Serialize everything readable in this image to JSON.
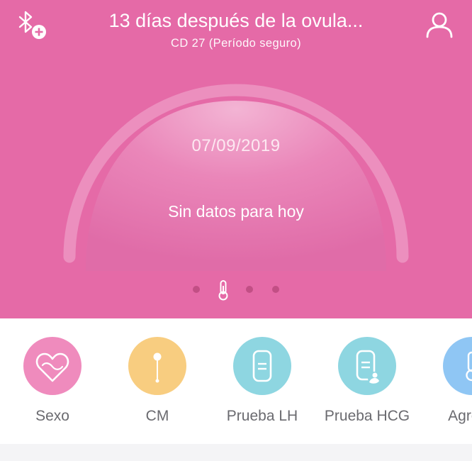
{
  "header": {
    "title": "13 días después de la ovula...",
    "subtitle": "CD 27 (Período seguro)",
    "bluetooth_icon": "bluetooth-add-icon",
    "profile_icon": "user-icon"
  },
  "gauge": {
    "date": "07/09/2019",
    "message": "Sin datos para hoy"
  },
  "pager": {
    "page_count": 4,
    "active_index": 1,
    "active_icon": "thermometer-icon"
  },
  "actions": [
    {
      "label": "Sexo",
      "icon": "heart-icon",
      "color": "#ef8bbd"
    },
    {
      "label": "CM",
      "icon": "cervical-mucus-icon",
      "color": "#f8cd80"
    },
    {
      "label": "Prueba LH",
      "icon": "lh-test-icon",
      "color": "#8ed6e1"
    },
    {
      "label": "Prueba HCG",
      "icon": "hcg-test-icon",
      "color": "#8ed6e1"
    },
    {
      "label": "Agrega",
      "icon": "thermometer-icon",
      "color": "#8fc6f4"
    }
  ],
  "colors": {
    "hero_bg": "#e56aa7",
    "pager_dot": "#c24f85",
    "label_gray": "#6a6a6f"
  }
}
